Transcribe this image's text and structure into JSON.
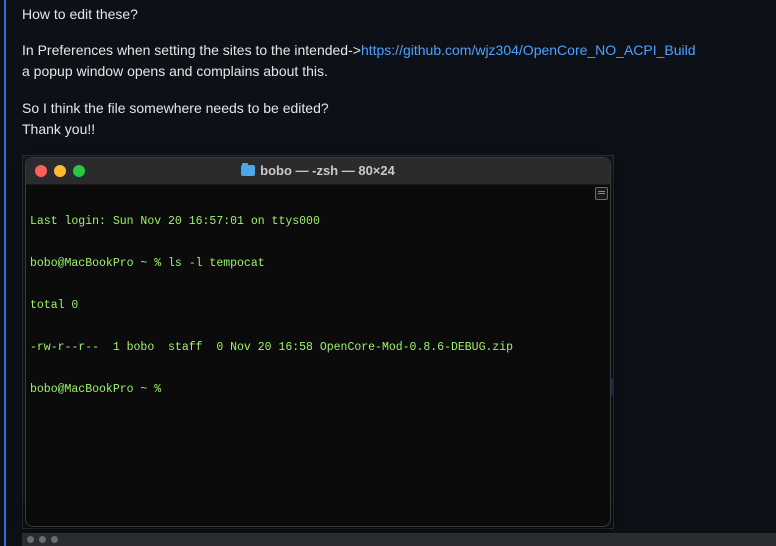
{
  "post": {
    "line1": "How to edit these?",
    "line2_prefix": "In Preferences when setting the sites to the intended->",
    "line2_link": "https://github.com/wjz304/OpenCore_NO_ACPI_Build",
    "line3": "a popup window opens and complains about this.",
    "line4": "So I think the file somewhere needs to be edited?",
    "line5": "Thank you!!"
  },
  "terminal": {
    "title": "bobo — -zsh — 80×24",
    "lines": [
      "Last login: Sun Nov 20 16:57:01 on ttys000",
      "bobo@MacBookPro ~ % ls -l tempocat",
      "total 0",
      "-rw-r--r--  1 bobo  staff  0 Nov 20 16:58 OpenCore-Mod-0.8.6-DEBUG.zip",
      "bobo@MacBookPro ~ % "
    ]
  },
  "colors": {
    "accent": "#2f6fd6",
    "link": "#4ea1ff",
    "terminal_text": "#9ff26b"
  }
}
